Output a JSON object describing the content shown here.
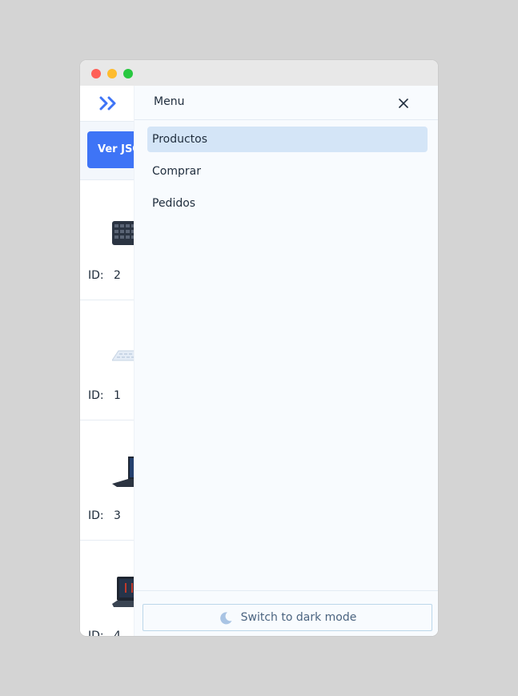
{
  "header": {
    "logo_icon": "double-chevron-right-icon"
  },
  "toolbar": {
    "json_button_label": "Ver JSON"
  },
  "products": [
    {
      "id_label": "ID:",
      "id": "2",
      "thumb": "keyboard-black-icon"
    },
    {
      "id_label": "ID:",
      "id": "1",
      "thumb": "keyboard-white-icon"
    },
    {
      "id_label": "ID:",
      "id": "3",
      "thumb": "laptop-icon"
    },
    {
      "id_label": "ID:",
      "id": "4",
      "thumb": "gaming-laptop-icon"
    }
  ],
  "drawer": {
    "title": "Menu",
    "close_icon": "close-icon",
    "items": [
      {
        "label": "Productos",
        "active": true
      },
      {
        "label": "Comprar",
        "active": false
      },
      {
        "label": "Pedidos",
        "active": false
      }
    ],
    "theme_toggle": {
      "label": "Switch to dark mode",
      "icon": "moon-icon"
    }
  },
  "colors": {
    "accent": "#3e74f6",
    "active_item_bg": "#d4e5f7",
    "drawer_bg": "#f8fbfe"
  }
}
